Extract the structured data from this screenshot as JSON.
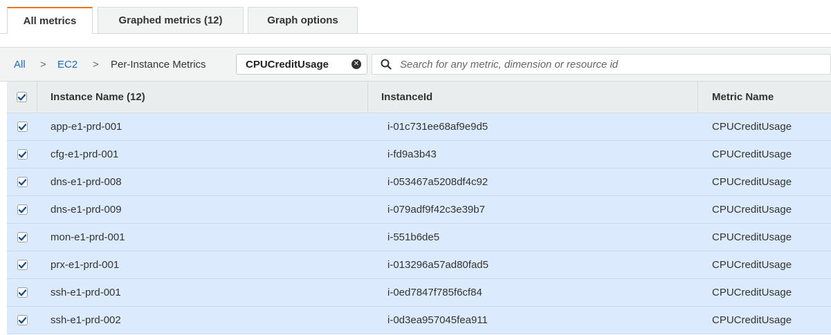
{
  "tabs": [
    {
      "label": "All metrics",
      "active": true
    },
    {
      "label": "Graphed metrics (12)",
      "active": false
    },
    {
      "label": "Graph options",
      "active": false
    }
  ],
  "breadcrumb": {
    "all": "All",
    "sep": ">",
    "ec2": "EC2",
    "current": "Per-Instance Metrics"
  },
  "filter_chip": {
    "label": "CPUCreditUsage",
    "close_icon": "close-circle-icon"
  },
  "search": {
    "placeholder": "Search for any metric, dimension or resource id",
    "value": "",
    "icon": "search-icon"
  },
  "table": {
    "headers": {
      "name": "Instance Name (12)",
      "id": "InstanceId",
      "metric": "Metric Name"
    },
    "header_checked": true,
    "rows": [
      {
        "name": "app-e1-prd-001",
        "id": "i-01c731ee68af9e9d5",
        "metric": "CPUCreditUsage",
        "checked": true
      },
      {
        "name": "cfg-e1-prd-001",
        "id": "i-fd9a3b43",
        "metric": "CPUCreditUsage",
        "checked": true
      },
      {
        "name": "dns-e1-prd-008",
        "id": "i-053467a5208df4c92",
        "metric": "CPUCreditUsage",
        "checked": true
      },
      {
        "name": "dns-e1-prd-009",
        "id": "i-079adf9f42c3e39b7",
        "metric": "CPUCreditUsage",
        "checked": true
      },
      {
        "name": "mon-e1-prd-001",
        "id": "i-551b6de5",
        "metric": "CPUCreditUsage",
        "checked": true
      },
      {
        "name": "prx-e1-prd-001",
        "id": "i-013296a57ad80fad5",
        "metric": "CPUCreditUsage",
        "checked": true
      },
      {
        "name": "ssh-e1-prd-001",
        "id": "i-0ed7847f785f6cf84",
        "metric": "CPUCreditUsage",
        "checked": true
      },
      {
        "name": "ssh-e1-prd-002",
        "id": "i-0d3ea957045fea911",
        "metric": "CPUCreditUsage",
        "checked": true
      }
    ]
  },
  "colors": {
    "accent_tab": "#e7751d",
    "link": "#1e6bb8",
    "row_selected": "#dbeafc",
    "check": "#1a4f8b"
  }
}
